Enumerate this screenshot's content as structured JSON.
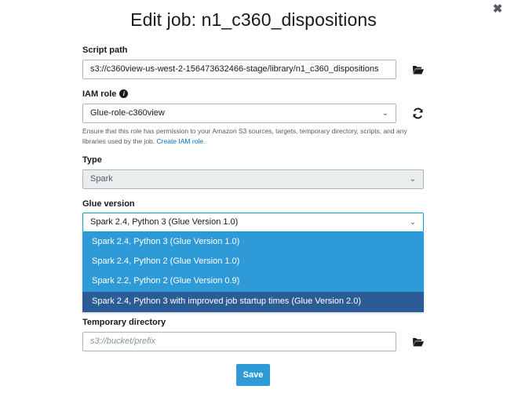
{
  "dialog": {
    "title": "Edit job: n1_c360_dispositions",
    "close_glyph": "✖"
  },
  "script_path": {
    "label": "Script path",
    "value": "s3://c360view-us-west-2-156473632466-stage/library/n1_c360_dispositions",
    "icon": "folder-open-icon"
  },
  "iam_role": {
    "label": "IAM role",
    "info_icon": "info-icon",
    "value": "Glue-role-c360view",
    "refresh_icon": "refresh-icon",
    "help_text": "Ensure that this role has permission to your Amazon S3 sources, targets, temporary directory, scripts, and any libraries used by the job.",
    "help_link": "Create IAM role."
  },
  "type": {
    "label": "Type",
    "value": "Spark"
  },
  "glue_version": {
    "label": "Glue version",
    "value": "Spark 2.4, Python 3 (Glue Version 1.0)",
    "options": [
      "Spark 2.4, Python 3 (Glue Version 1.0)",
      "Spark 2.4, Python 2 (Glue Version 1.0)",
      "Spark 2.2, Python 2 (Glue Version 0.9)",
      "Spark 2.4, Python 3 with improved job startup times (Glue Version 2.0)"
    ],
    "highlighted_index": 3
  },
  "temp_dir": {
    "label": "Temporary directory",
    "placeholder": "s3://bucket/prefix",
    "icon": "folder-open-icon"
  },
  "save_label": "Save",
  "colors": {
    "accent": "#2e9ad8",
    "selected_option": "#2c5c97",
    "link": "#0073bb"
  }
}
